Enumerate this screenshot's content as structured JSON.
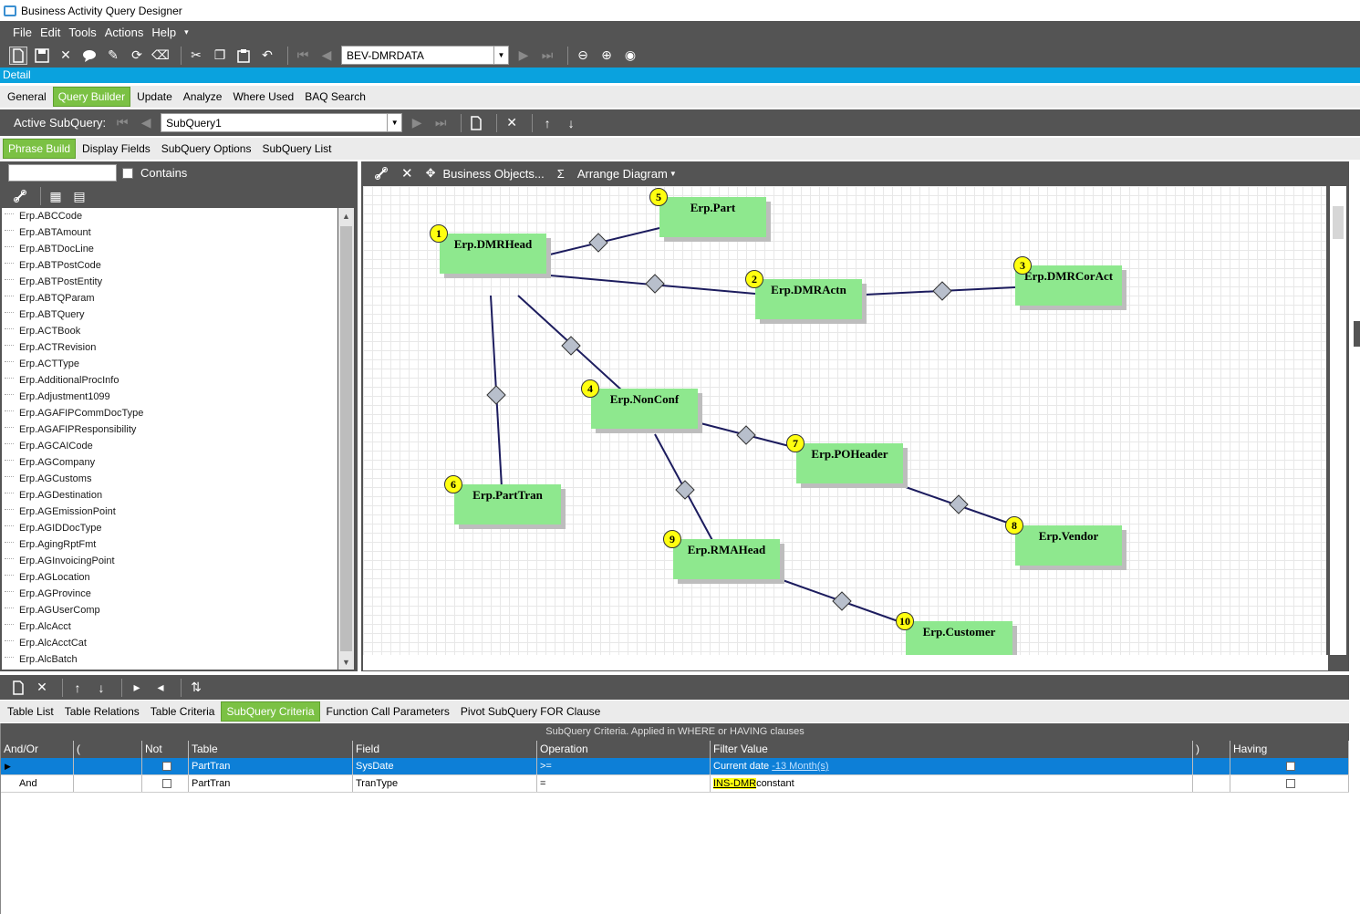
{
  "window": {
    "title": "Business Activity Query Designer"
  },
  "menu": [
    "File",
    "Edit",
    "Tools",
    "Actions",
    "Help"
  ],
  "toolbar": {
    "query_id": "BEV-DMRDATA"
  },
  "detail_label": "Detail",
  "main_tabs": [
    {
      "label": "General",
      "selected": false
    },
    {
      "label": "Query Builder",
      "selected": true
    },
    {
      "label": "Update",
      "selected": false
    },
    {
      "label": "Analyze",
      "selected": false
    },
    {
      "label": "Where Used",
      "selected": false
    },
    {
      "label": "BAQ Search",
      "selected": false
    }
  ],
  "subquery": {
    "label": "Active SubQuery:",
    "value": "SubQuery1"
  },
  "sub_tabs": [
    {
      "label": "Phrase Build",
      "selected": true
    },
    {
      "label": "Display Fields",
      "selected": false
    },
    {
      "label": "SubQuery Options",
      "selected": false
    },
    {
      "label": "SubQuery List",
      "selected": false
    }
  ],
  "search": {
    "contains_label": "Contains",
    "value": ""
  },
  "tables": [
    "Erp.ABCCode",
    "Erp.ABTAmount",
    "Erp.ABTDocLine",
    "Erp.ABTPostCode",
    "Erp.ABTPostEntity",
    "Erp.ABTQParam",
    "Erp.ABTQuery",
    "Erp.ACTBook",
    "Erp.ACTRevision",
    "Erp.ACTType",
    "Erp.AdditionalProcInfo",
    "Erp.Adjustment1099",
    "Erp.AGAFIPCommDocType",
    "Erp.AGAFIPResponsibility",
    "Erp.AGCAICode",
    "Erp.AGCompany",
    "Erp.AGCustoms",
    "Erp.AGDestination",
    "Erp.AGEmissionPoint",
    "Erp.AGIDDocType",
    "Erp.AgingRptFmt",
    "Erp.AGInvoicingPoint",
    "Erp.AGLocation",
    "Erp.AGProvince",
    "Erp.AGUserComp",
    "Erp.AlcAcct",
    "Erp.AlcAcctCat",
    "Erp.AlcBatch"
  ],
  "diagram_tools": {
    "business_objects": "Business Objects...",
    "sigma": "Σ",
    "arrange": "Arrange Diagram"
  },
  "diagram_nodes": [
    {
      "num": "1",
      "name": "Erp.DMRHead"
    },
    {
      "num": "2",
      "name": "Erp.DMRActn"
    },
    {
      "num": "3",
      "name": "Erp.DMRCorAct"
    },
    {
      "num": "4",
      "name": "Erp.NonConf"
    },
    {
      "num": "5",
      "name": "Erp.Part"
    },
    {
      "num": "6",
      "name": "Erp.PartTran"
    },
    {
      "num": "7",
      "name": "Erp.POHeader"
    },
    {
      "num": "8",
      "name": "Erp.Vendor"
    },
    {
      "num": "9",
      "name": "Erp.RMAHead"
    },
    {
      "num": "10",
      "name": "Erp.Customer"
    }
  ],
  "bottom_tabs": [
    {
      "label": "Table List",
      "selected": false
    },
    {
      "label": "Table Relations",
      "selected": false
    },
    {
      "label": "Table Criteria",
      "selected": false
    },
    {
      "label": "SubQuery Criteria",
      "selected": true
    },
    {
      "label": "Function Call Parameters",
      "selected": false
    },
    {
      "label": "Pivot SubQuery FOR Clause",
      "selected": false
    }
  ],
  "criteria": {
    "caption": "SubQuery Criteria. Applied in WHERE or HAVING clauses",
    "columns": [
      "And/Or",
      "(",
      "Not",
      "Table",
      "Field",
      "Operation",
      "Filter Value",
      ")",
      "Having"
    ],
    "rows": [
      {
        "andor": "",
        "paren_open": "",
        "not": false,
        "table": "PartTran",
        "field": "SysDate",
        "operation": ">=",
        "filter_prefix": "Current date",
        "filter_link": "-13 Month(s)",
        "filter_suffix": "",
        "paren_close": "",
        "having": false,
        "selected": true
      },
      {
        "andor": "And",
        "paren_open": "",
        "not": false,
        "table": "PartTran",
        "field": "TranType",
        "operation": "=",
        "filter_prefix": "",
        "filter_link": "INS-DMR",
        "filter_suffix": "constant",
        "paren_close": "",
        "having": false,
        "selected": false
      }
    ]
  }
}
